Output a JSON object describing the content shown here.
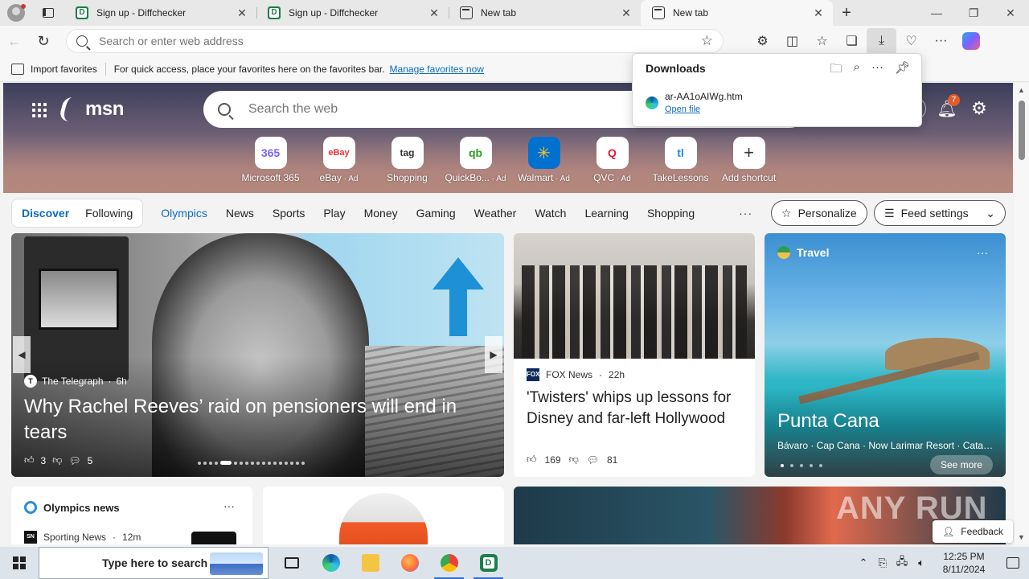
{
  "tabs": [
    {
      "title": "Sign up - Diffchecker",
      "favicon": "diffchecker-icon",
      "active": false
    },
    {
      "title": "Sign up - Diffchecker",
      "favicon": "diffchecker-icon",
      "active": false
    },
    {
      "title": "New tab",
      "favicon": "newtab-icon",
      "active": false
    },
    {
      "title": "New tab",
      "favicon": "newtab-icon",
      "active": true
    }
  ],
  "address_bar": {
    "placeholder": "Search or enter web address"
  },
  "favorites_bar": {
    "import_label": "Import favorites",
    "hint": "For quick access, place your favorites here on the favorites bar.",
    "manage_link": "Manage favorites now"
  },
  "downloads": {
    "title": "Downloads",
    "items": [
      {
        "filename": "ar-AA1oAIWg.htm",
        "action": "Open file"
      }
    ]
  },
  "msn": {
    "logo": "msn",
    "search_placeholder": "Search the web",
    "notifications_count": "7",
    "shortcuts": [
      {
        "label": "Microsoft 365",
        "ad": "",
        "glyph": "365"
      },
      {
        "label": "eBay",
        "ad": " · Ad",
        "glyph": "eBay"
      },
      {
        "label": "Shopping",
        "ad": "",
        "glyph": "tag"
      },
      {
        "label": "QuickBo...",
        "ad": " · Ad",
        "glyph": "qb"
      },
      {
        "label": "Walmart",
        "ad": " · Ad",
        "glyph": "✳"
      },
      {
        "label": "QVC",
        "ad": " · Ad",
        "glyph": "Q"
      },
      {
        "label": "TakeLessons",
        "ad": "",
        "glyph": "tl"
      },
      {
        "label": "Add shortcut",
        "ad": "",
        "glyph": "+"
      }
    ],
    "feed_tabs": {
      "discover": "Discover",
      "following": "Following"
    },
    "nav_links": [
      "Olympics",
      "News",
      "Sports",
      "Play",
      "Money",
      "Gaming",
      "Weather",
      "Watch",
      "Learning",
      "Shopping"
    ],
    "more": "···",
    "personalize": "Personalize",
    "feed_settings": "Feed settings"
  },
  "cards": {
    "main": {
      "source": "The Telegraph",
      "time": "6h",
      "headline": "Why Rachel Reeves’ raid on pensioners will end in tears",
      "likes": "3",
      "comments": "5"
    },
    "fox": {
      "source": "FOX News",
      "time": "22h",
      "headline": "'Twisters' whips up lessons for Disney and far-left Hollywood",
      "likes": "169",
      "comments": "81"
    },
    "travel": {
      "category": "Travel",
      "place": "Punta Cana",
      "subtitle": "Bávaro · Cap Cana · Now Larimar Resort · Catalin...",
      "see_more": "See more"
    },
    "olympics": {
      "title": "Olympics news",
      "source": "Sporting News",
      "time": "12m"
    }
  },
  "feedback": "Feedback",
  "watermark": "ANY RUN",
  "taskbar": {
    "search_placeholder": "Type here to search",
    "time": "12:25 PM",
    "date": "8/11/2024"
  }
}
